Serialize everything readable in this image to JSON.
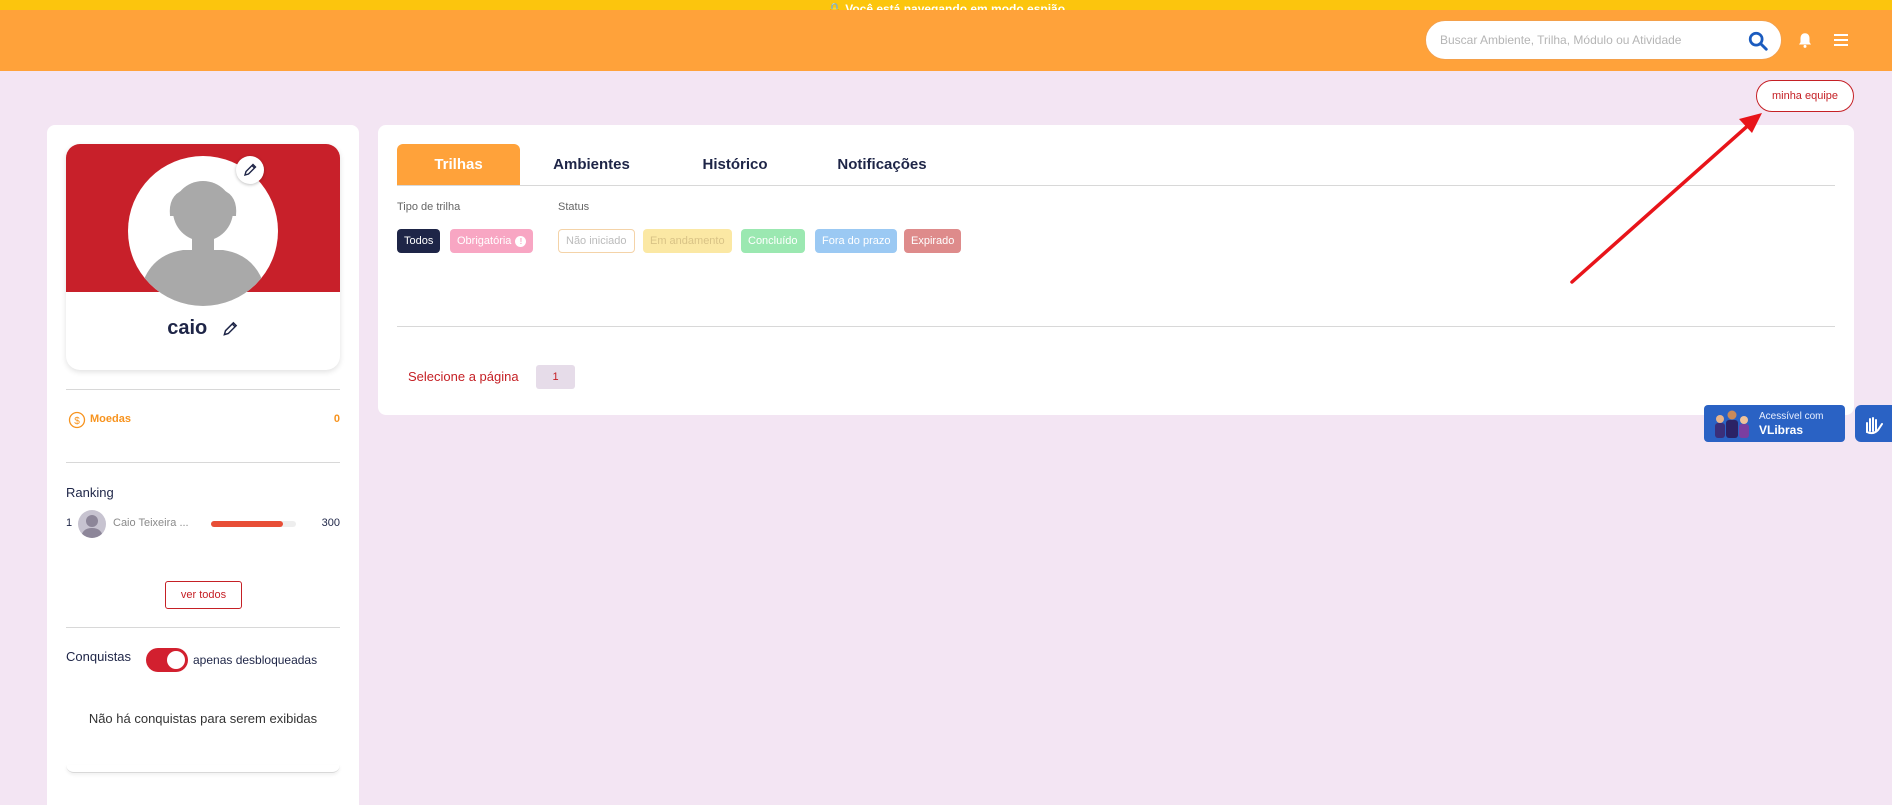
{
  "spy_banner": {
    "text": "🔒 Você está navegando em modo espião"
  },
  "header": {
    "search_placeholder": "Buscar Ambiente, Trilha, Módulo ou Atividade",
    "search_icon": "search-icon",
    "bell_icon": "bell-icon",
    "menu_icon": "hamburger-menu-icon"
  },
  "team_button": {
    "label": "minha equipe"
  },
  "profile": {
    "name": "caio",
    "banner_color": "#c8202a"
  },
  "coins": {
    "label": "Moedas",
    "value": "0"
  },
  "ranking": {
    "title": "Ranking",
    "entries": [
      {
        "position": "1",
        "name": "Caio Teixeira ...",
        "points": "300",
        "progress": 0.85
      }
    ],
    "see_all_label": "ver todos"
  },
  "achievements": {
    "title": "Conquistas",
    "toggle_label": "apenas desbloqueadas",
    "toggle_on": true,
    "empty_message": "Não há conquistas para serem exibidas"
  },
  "main": {
    "tabs": [
      {
        "label": "Trilhas",
        "active": true
      },
      {
        "label": "Ambientes",
        "active": false
      },
      {
        "label": "Histórico",
        "active": false
      },
      {
        "label": "Notificações",
        "active": false
      }
    ],
    "filters": {
      "type_label": "Tipo de trilha",
      "status_label": "Status",
      "type_chips": [
        "Todos",
        "Obrigatória"
      ],
      "status_chips": [
        "Não iniciado",
        "Em andamento",
        "Concluído",
        "Fora do prazo",
        "Expirado"
      ]
    },
    "pagination": {
      "label": "Selecione a página",
      "pages": [
        "1"
      ]
    }
  },
  "vlibras": {
    "line1": "Acessível com",
    "line2": "VLibras"
  },
  "colors": {
    "topbar": "#ffa23a",
    "spy_bar": "#fcc50d",
    "background": "#f3e5f3",
    "accent_red": "#c52025",
    "navy": "#1e2547",
    "arrow": "#e8141a"
  }
}
